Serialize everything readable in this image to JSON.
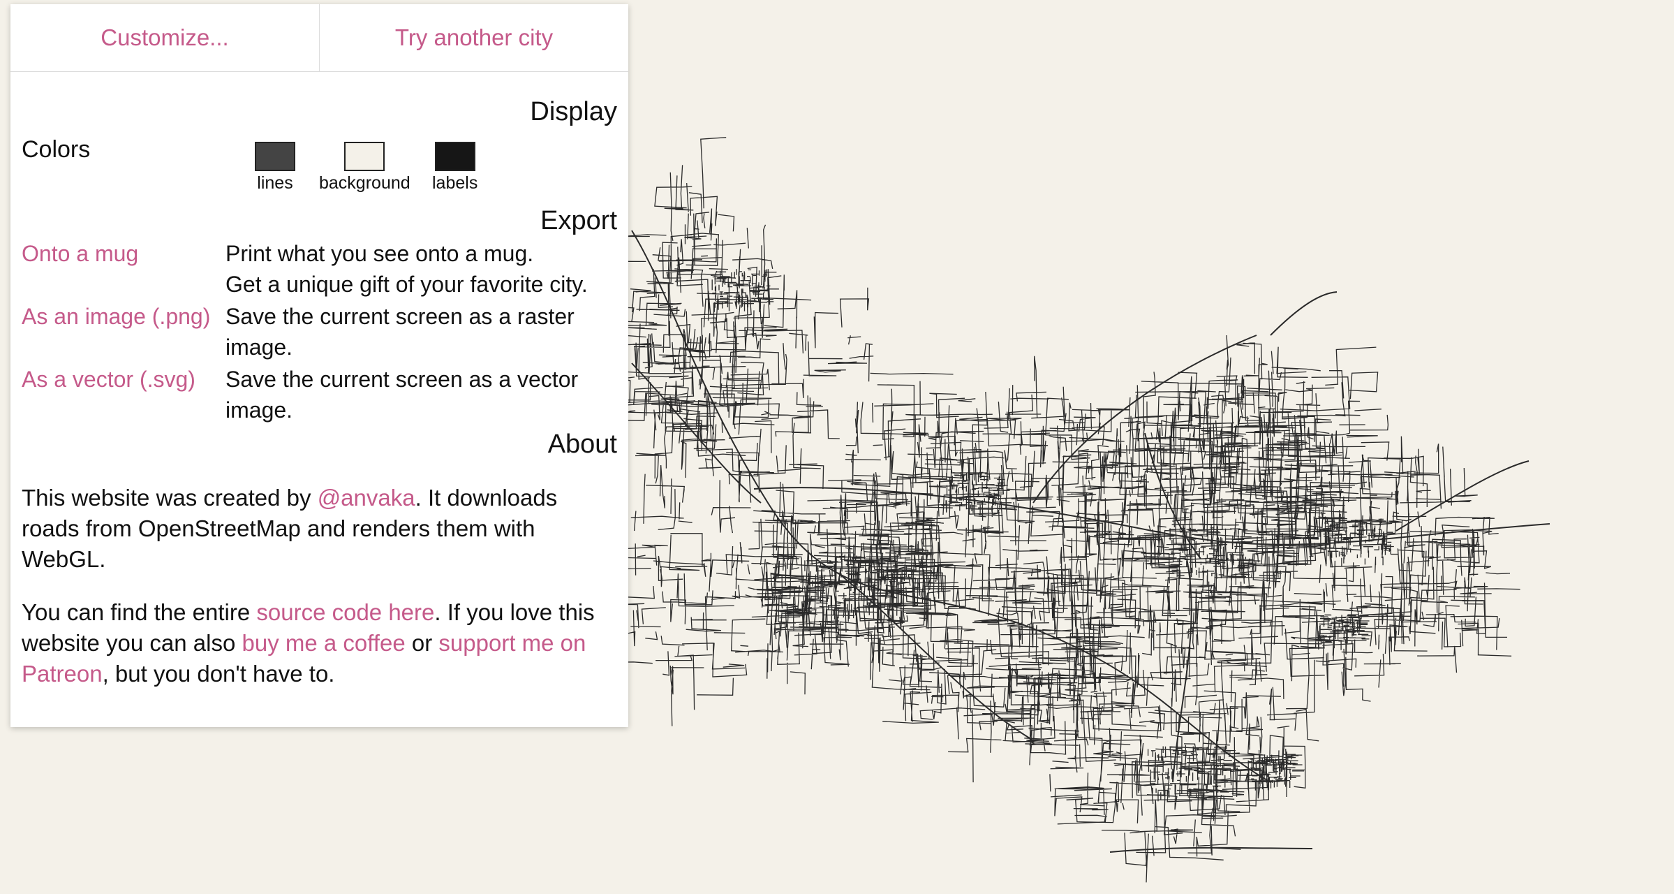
{
  "top_bar": {
    "customize_label": "Customize...",
    "try_city_label": "Try another city"
  },
  "display": {
    "title": "Display",
    "colors_label": "Colors",
    "swatches": [
      {
        "label": "lines",
        "color": "#444444"
      },
      {
        "label": "background",
        "color": "#f4f1e9"
      },
      {
        "label": "labels",
        "color": "#161616"
      }
    ]
  },
  "export": {
    "title": "Export",
    "items": [
      {
        "link": "Onto a mug",
        "desc_line1": "Print what you see onto a mug.",
        "desc_line2": "Get a unique gift of your favorite city."
      },
      {
        "link": "As an image (.png)",
        "desc_line1": "Save the current screen as a raster",
        "desc_line2": "image."
      },
      {
        "link": "As a vector (.svg)",
        "desc_line1": "Save the current screen as a vector",
        "desc_line2": "image."
      }
    ]
  },
  "about": {
    "title": "About",
    "p1_before": "This website was created by ",
    "p1_link": "@anvaka",
    "p1_after": ". It downloads roads from OpenStreetMap and renders them with WebGL.",
    "p2_before": "You can find the entire ",
    "p2_link1": "source code here",
    "p2_mid1": ". If you love this website you can also ",
    "p2_link2": "buy me a coffee",
    "p2_mid2": " or ",
    "p2_link3": "support me on Patreon",
    "p2_after": ", but you don't have to."
  },
  "colors": {
    "background": "#f4f1e9",
    "accent": "#c55a8a",
    "lines": "#444444"
  }
}
